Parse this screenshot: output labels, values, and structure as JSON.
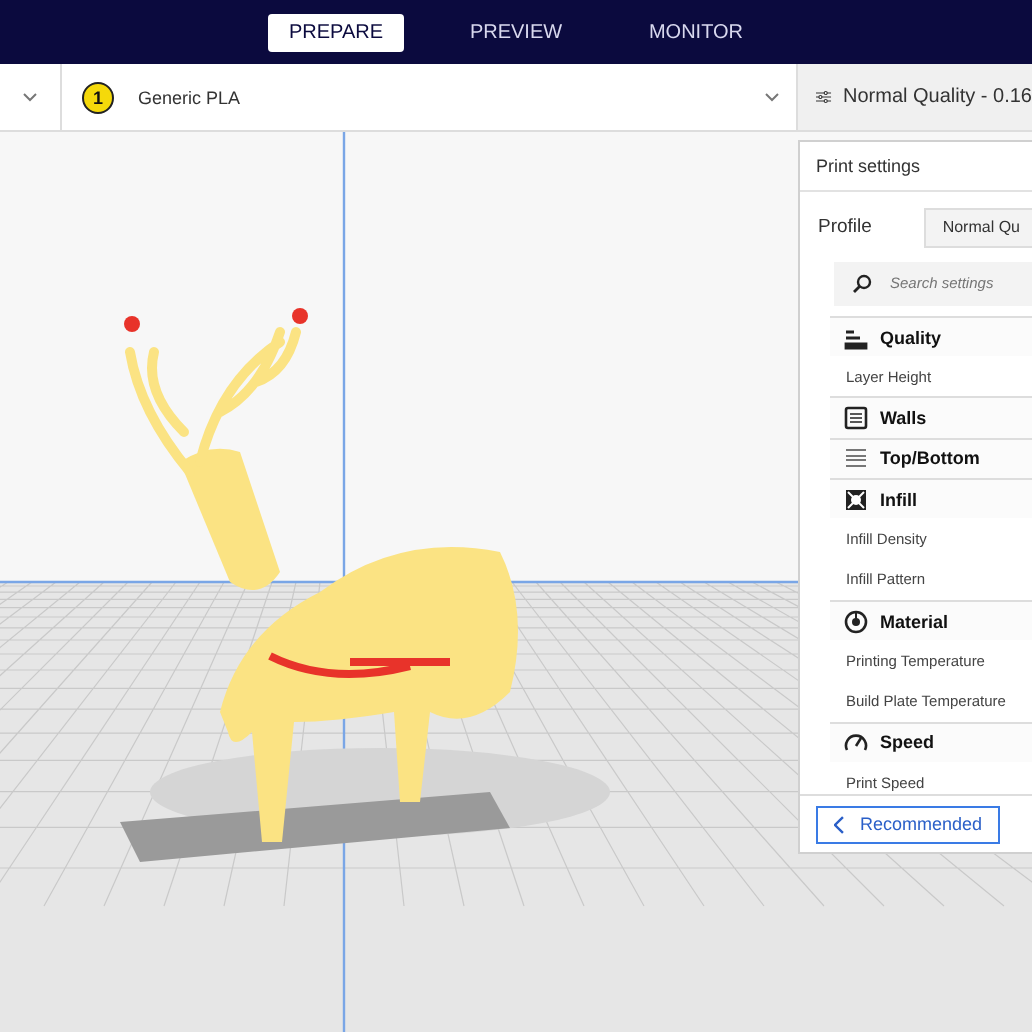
{
  "tabs": [
    {
      "label": "PREPARE",
      "selected": true
    },
    {
      "label": "PREVIEW",
      "selected": false
    },
    {
      "label": "MONITOR",
      "selected": false
    }
  ],
  "toolbar": {
    "extruder_number": "1",
    "material": "Generic PLA",
    "quality": "Normal Quality - 0.16"
  },
  "print_settings": {
    "title": "Print settings",
    "profile_label": "Profile",
    "profile_value": "Normal Qu",
    "search": {
      "placeholder": "Search settings"
    },
    "categories": [
      {
        "name": "Quality",
        "kind": "quality",
        "settings": [
          "Layer Height"
        ]
      },
      {
        "name": "Walls",
        "kind": "walls"
      },
      {
        "name": "Top/Bottom",
        "kind": "topbottom"
      },
      {
        "name": "Infill",
        "kind": "infill",
        "settings": [
          "Infill Density",
          "Infill Pattern"
        ]
      },
      {
        "name": "Material",
        "kind": "material",
        "settings": [
          "Printing Temperature",
          "Build Plate Temperature"
        ]
      },
      {
        "name": "Speed",
        "kind": "speed",
        "settings": [
          "Print Speed"
        ]
      }
    ],
    "recommended_button": "Recommended"
  }
}
